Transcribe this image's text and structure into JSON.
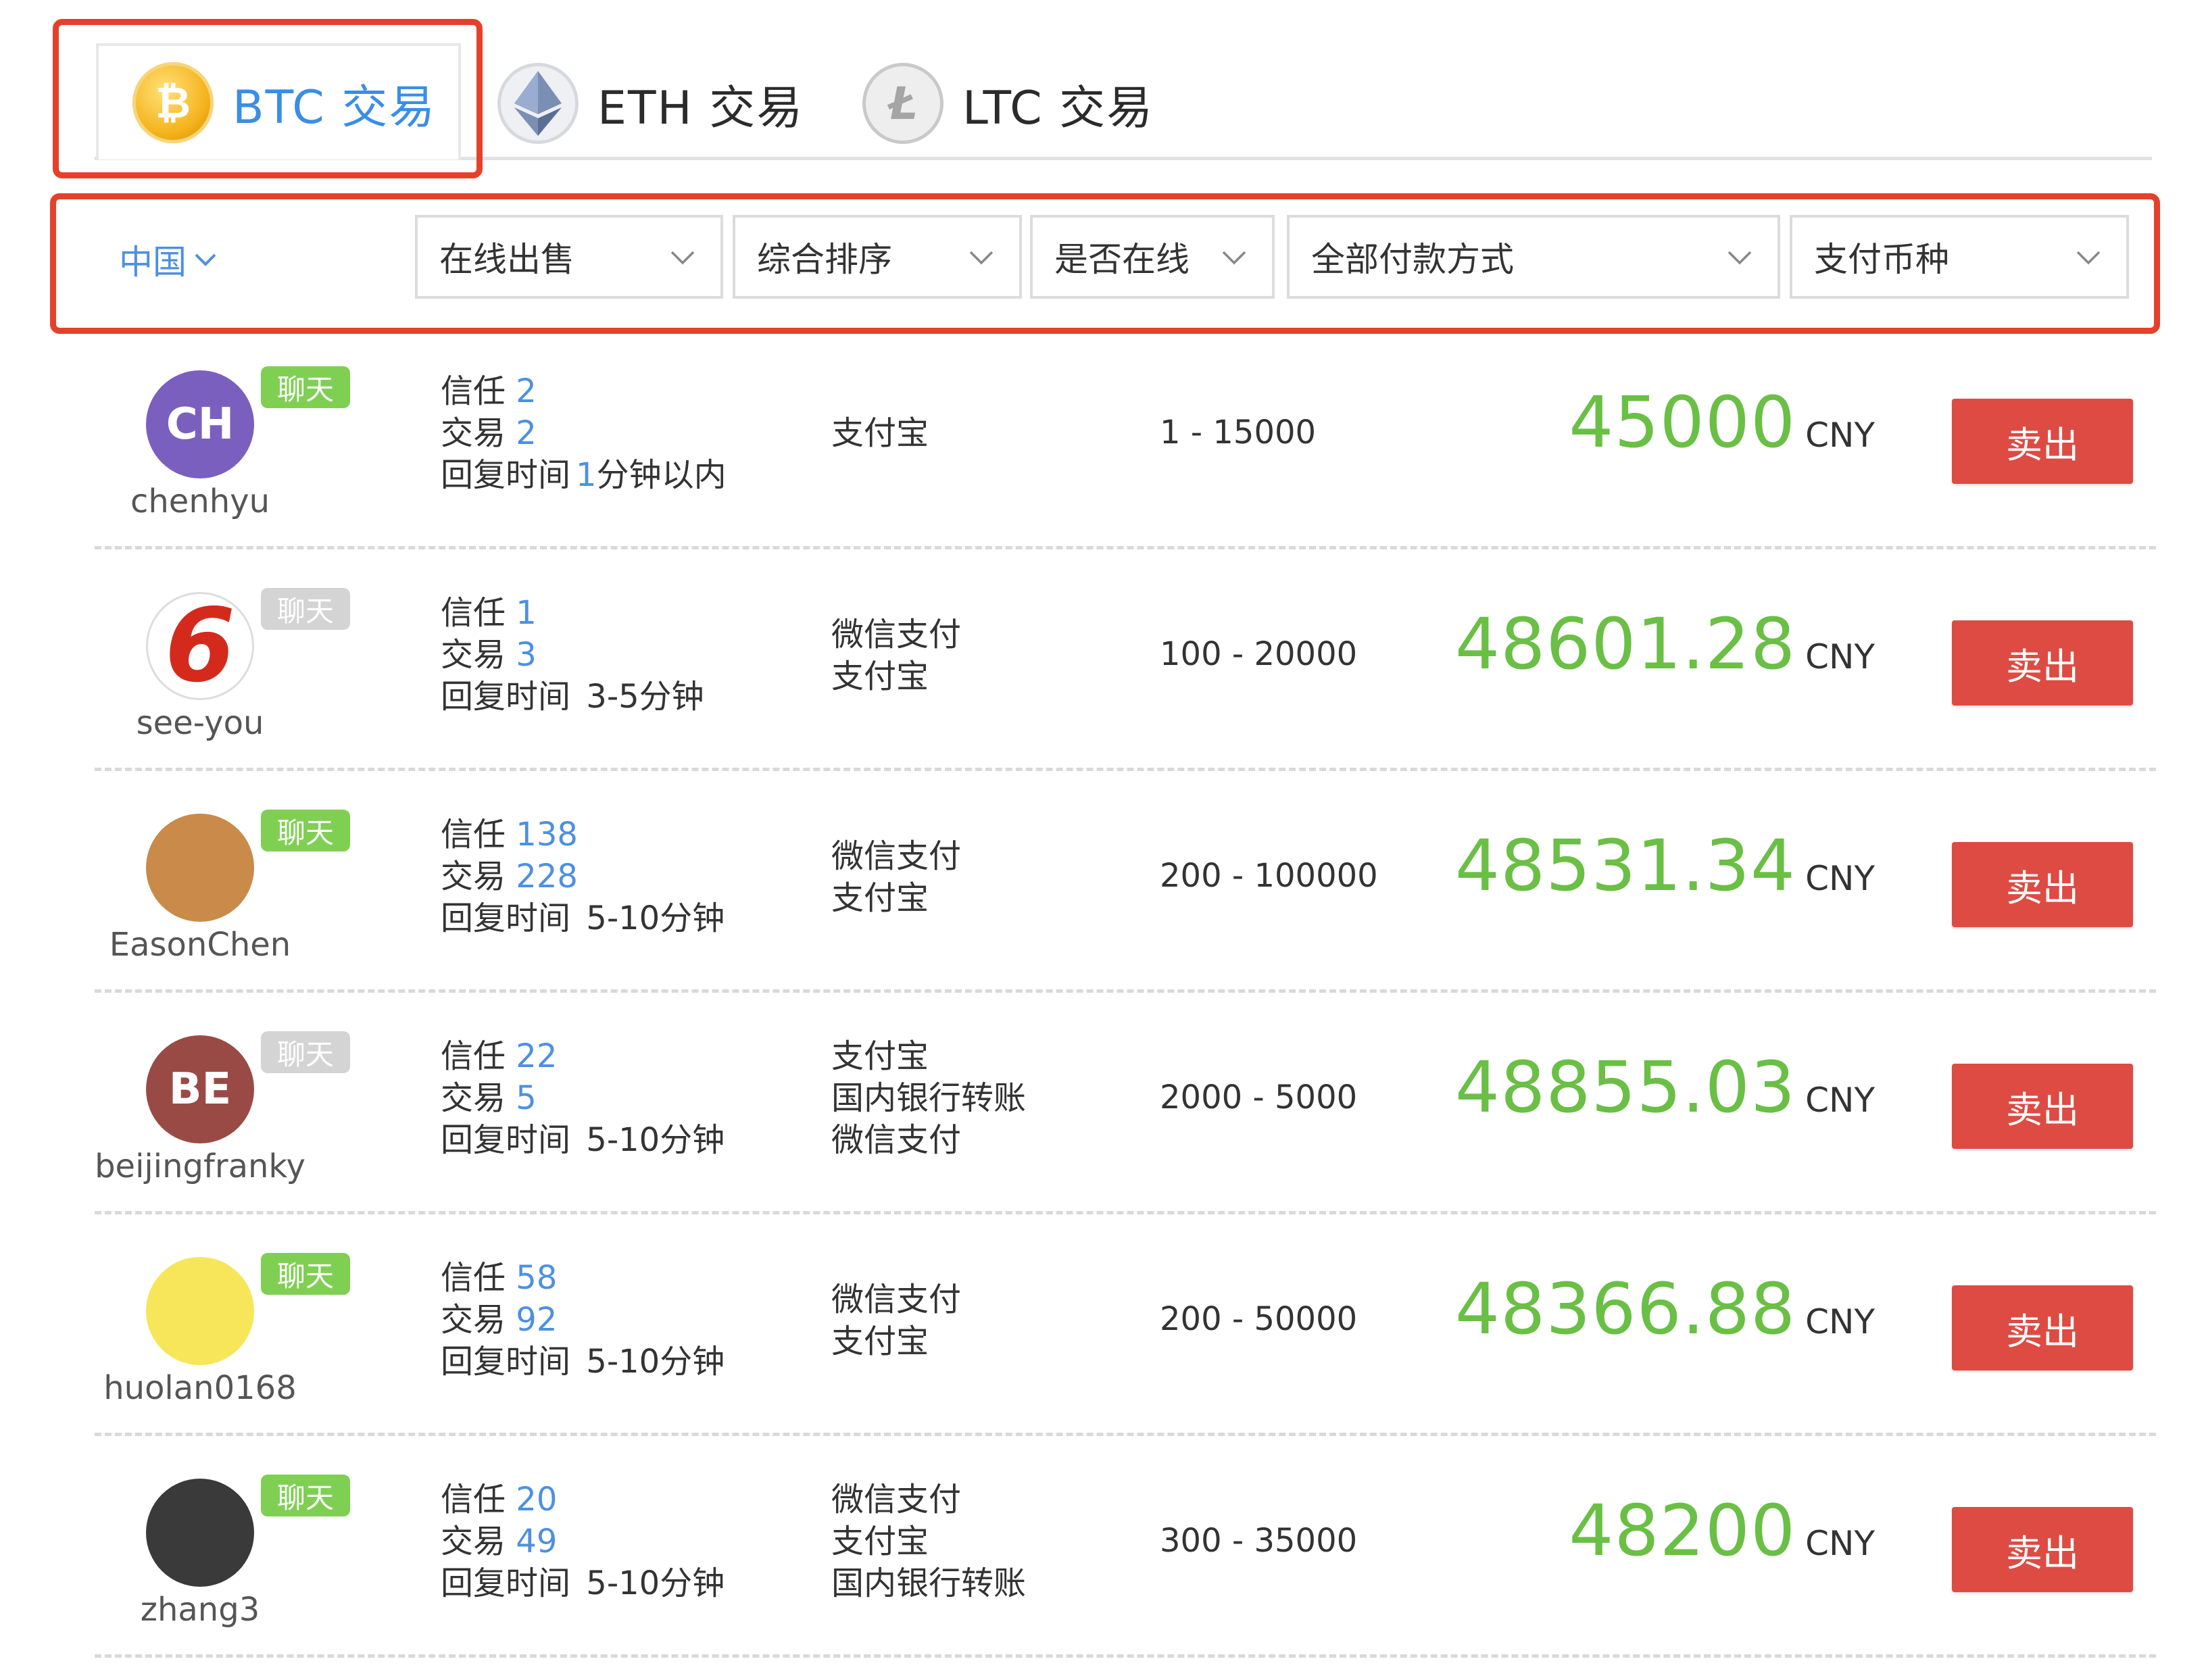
{
  "tabs": [
    {
      "label": "BTC 交易",
      "icon": "bitcoin-icon",
      "active": true
    },
    {
      "label": "ETH 交易",
      "icon": "ethereum-icon",
      "active": false
    },
    {
      "label": "LTC 交易",
      "icon": "litecoin-icon",
      "active": false
    }
  ],
  "filters": {
    "region": "中国",
    "trade_type": "在线出售",
    "sort": "综合排序",
    "online": "是否在线",
    "payment_method": "全部付款方式",
    "currency": "支付币种"
  },
  "labels": {
    "chat": "聊天",
    "trust": "信任",
    "trades": "交易",
    "reply_time": "回复时间",
    "sell": "卖出"
  },
  "colors": {
    "accent_blue": "#4d90e0",
    "price_green": "#6abf45",
    "sell_red": "#dd4b43",
    "chat_online": "#7fcf53",
    "chat_offline": "#d4d4d4",
    "highlight_red": "#e6402b"
  },
  "offers": [
    {
      "username": "chenhyu",
      "avatar_text": "CH",
      "avatar_color": "#7b5fbf",
      "chat_online": true,
      "trust": "2",
      "trades": "2",
      "reply_num": "1",
      "reply_suffix": "分钟以内",
      "payments": [
        "支付宝"
      ],
      "limit": "1 - 15000",
      "price": "45000",
      "currency": "CNY"
    },
    {
      "username": "see-you",
      "avatar_text": "6",
      "avatar_color": "#ffffff",
      "chat_online": false,
      "trust": "1",
      "trades": "3",
      "reply_num": "",
      "reply_suffix": " 3-5分钟",
      "payments": [
        "微信支付",
        "支付宝"
      ],
      "limit": "100 - 20000",
      "price": "48601.28",
      "currency": "CNY"
    },
    {
      "username": "EasonChen",
      "avatar_text": "",
      "avatar_color": "#c98a4a",
      "chat_online": true,
      "trust": "138",
      "trades": "228",
      "reply_num": "",
      "reply_suffix": " 5-10分钟",
      "payments": [
        "微信支付",
        "支付宝"
      ],
      "limit": "200 - 100000",
      "price": "48531.34",
      "currency": "CNY"
    },
    {
      "username": "beijingfranky",
      "avatar_text": "BE",
      "avatar_color": "#9a4a45",
      "chat_online": false,
      "trust": "22",
      "trades": "5",
      "reply_num": "",
      "reply_suffix": " 5-10分钟",
      "payments": [
        "支付宝",
        "国内银行转账",
        "微信支付"
      ],
      "limit": "2000 - 5000",
      "price": "48855.03",
      "currency": "CNY"
    },
    {
      "username": "huolan0168",
      "avatar_text": "",
      "avatar_color": "#f7e65a",
      "chat_online": true,
      "trust": "58",
      "trades": "92",
      "reply_num": "",
      "reply_suffix": " 5-10分钟",
      "payments": [
        "微信支付",
        "支付宝"
      ],
      "limit": "200 - 50000",
      "price": "48366.88",
      "currency": "CNY"
    },
    {
      "username": "zhang3",
      "avatar_text": "",
      "avatar_color": "#3a3a3a",
      "chat_online": true,
      "trust": "20",
      "trades": "49",
      "reply_num": "",
      "reply_suffix": " 5-10分钟",
      "payments": [
        "微信支付",
        "支付宝",
        "国内银行转账"
      ],
      "limit": "300 - 35000",
      "price": "48200",
      "currency": "CNY"
    }
  ]
}
